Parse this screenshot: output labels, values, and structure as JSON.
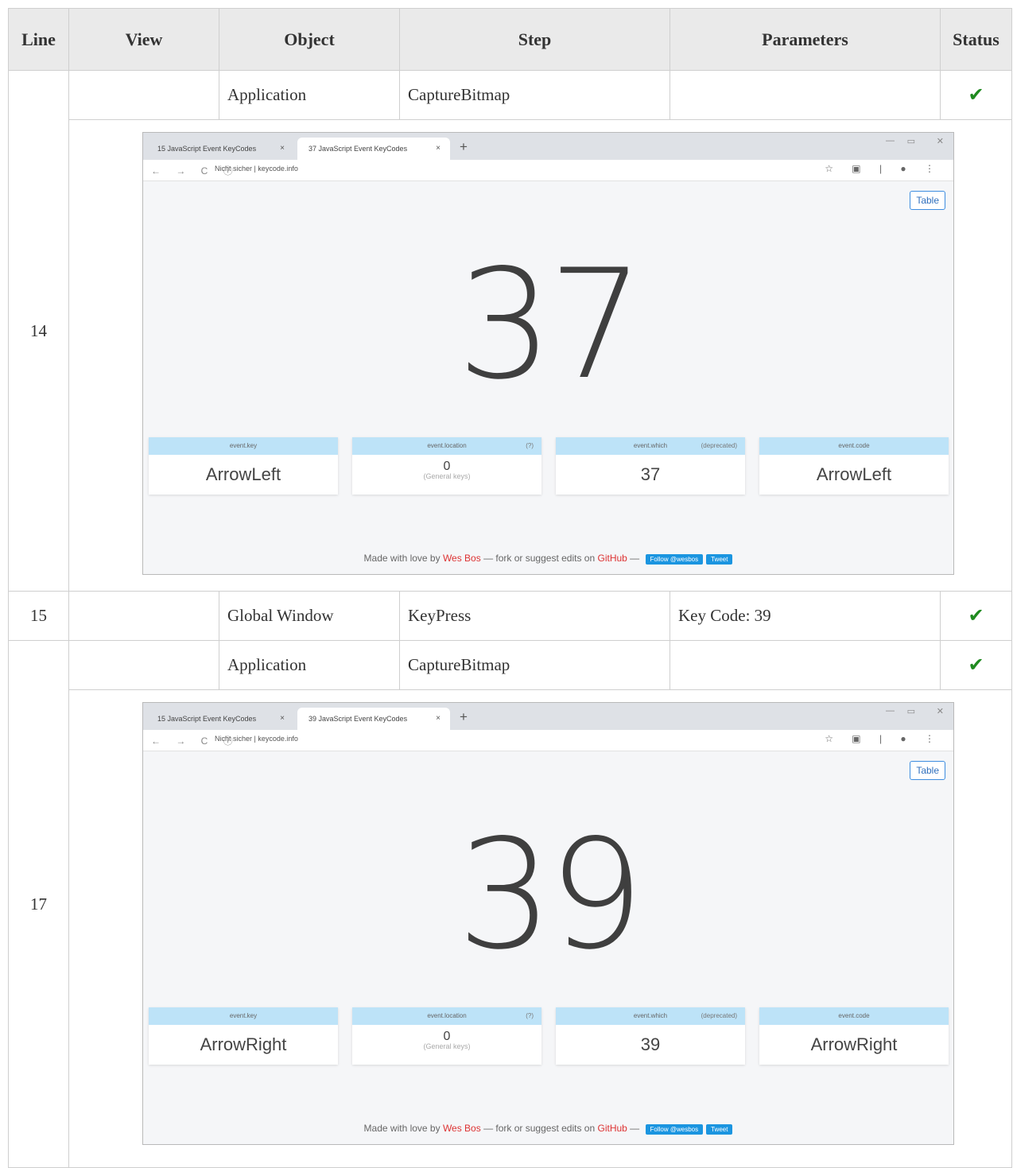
{
  "headers": {
    "line": "Line",
    "view": "View",
    "object": "Object",
    "step": "Step",
    "parameters": "Parameters",
    "status": "Status"
  },
  "rows": [
    {
      "line": "14",
      "view": "",
      "object": "Application",
      "step": "CaptureBitmap",
      "parameters": "",
      "status_icon": "check-icon",
      "shot": {
        "tab1": "15 JavaScript Event KeyCodes",
        "tab2": "37 JavaScript Event KeyCodes",
        "url": "Nicht sicher | keycode.info",
        "table_btn": "Table",
        "big": "37",
        "cards": [
          {
            "head": "event.key",
            "aux": "",
            "value": "ArrowLeft",
            "sub": ""
          },
          {
            "head": "event.location",
            "aux": "(?)",
            "value": "0",
            "sub": "(General keys)"
          },
          {
            "head": "event.which",
            "aux": "(deprecated)",
            "value": "37",
            "sub": ""
          },
          {
            "head": "event.code",
            "aux": "",
            "value": "ArrowLeft",
            "sub": ""
          }
        ],
        "footer_pre": "Made with love by ",
        "footer_author": "Wes Bos",
        "footer_mid": " — fork or suggest edits on ",
        "footer_gh": "GitHub",
        "footer_post": " — ",
        "follow": "Follow @wesbos",
        "tweet": "Tweet"
      }
    },
    {
      "line": "15",
      "view": "",
      "object": "Global Window",
      "step": "KeyPress",
      "parameters": "Key Code: 39",
      "status_icon": "check-icon"
    },
    {
      "line": "17",
      "view": "",
      "object": "Application",
      "step": "CaptureBitmap",
      "parameters": "",
      "status_icon": "check-icon",
      "shot": {
        "tab1": "15 JavaScript Event KeyCodes",
        "tab2": "39 JavaScript Event KeyCodes",
        "url": "Nicht sicher | keycode.info",
        "table_btn": "Table",
        "big": "39",
        "cards": [
          {
            "head": "event.key",
            "aux": "",
            "value": "ArrowRight",
            "sub": ""
          },
          {
            "head": "event.location",
            "aux": "(?)",
            "value": "0",
            "sub": "(General keys)"
          },
          {
            "head": "event.which",
            "aux": "(deprecated)",
            "value": "39",
            "sub": ""
          },
          {
            "head": "event.code",
            "aux": "",
            "value": "ArrowRight",
            "sub": ""
          }
        ],
        "footer_pre": "Made with love by ",
        "footer_author": "Wes Bos",
        "footer_mid": " — fork or suggest edits on ",
        "footer_gh": "GitHub",
        "footer_post": " — ",
        "follow": "Follow @wesbos",
        "tweet": "Tweet"
      }
    }
  ],
  "icons": {
    "check": "✔",
    "close_tab": "×",
    "new_tab": "+",
    "nav": "← → C ⓘ",
    "toolbar_right": "☆ ▣ | ● ⋮",
    "minimize": "—",
    "maximize": "▭",
    "close_window": "✕"
  },
  "colors": {
    "status_ok": "#1f8a1f",
    "card_header": "#bde3f8",
    "link_red": "#dd3333",
    "tweet_blue": "#1b95e0"
  }
}
